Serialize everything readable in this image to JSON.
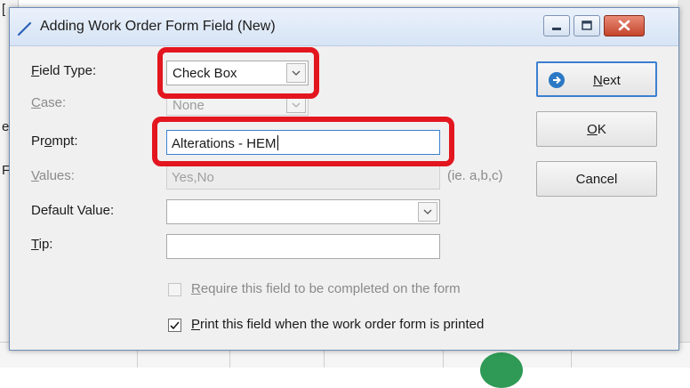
{
  "background": {
    "fragments": [
      "[",
      "e",
      "F"
    ]
  },
  "dialog": {
    "title": "Adding Work Order Form Field  (New)",
    "fields": {
      "field_type": {
        "label_pre": "",
        "label_ul": "F",
        "label_post": "ield Type:",
        "value": "Check Box"
      },
      "case": {
        "label_pre": "",
        "label_ul": "C",
        "label_post": "ase:",
        "value": "None"
      },
      "prompt": {
        "label_pre": "Pr",
        "label_ul": "o",
        "label_post": "mpt:",
        "value": "Alterations - HEM"
      },
      "values": {
        "label_pre": "",
        "label_ul": "V",
        "label_post": "alues:",
        "value": "Yes,No",
        "hint": "(ie. a,b,c)"
      },
      "default_value": {
        "label": "Default Value:",
        "value": ""
      },
      "tip": {
        "label_pre": "",
        "label_ul": "T",
        "label_post": "ip:",
        "value": ""
      }
    },
    "checkboxes": {
      "require": {
        "label_pre": "",
        "label_ul": "R",
        "label_post": "equire this field to be completed on the form",
        "checked": false,
        "enabled": false
      },
      "print": {
        "label_pre": "",
        "label_ul": "P",
        "label_post": "rint this field when the work order form is printed",
        "checked": true,
        "enabled": true
      }
    },
    "buttons": {
      "next": {
        "label_pre": "",
        "label_ul": "N",
        "label_post": "ext"
      },
      "ok": {
        "label_pre": "",
        "label_ul": "O",
        "label_post": "K"
      },
      "cancel": {
        "label": "Cancel"
      }
    }
  },
  "annotation_color": "#e3161f"
}
